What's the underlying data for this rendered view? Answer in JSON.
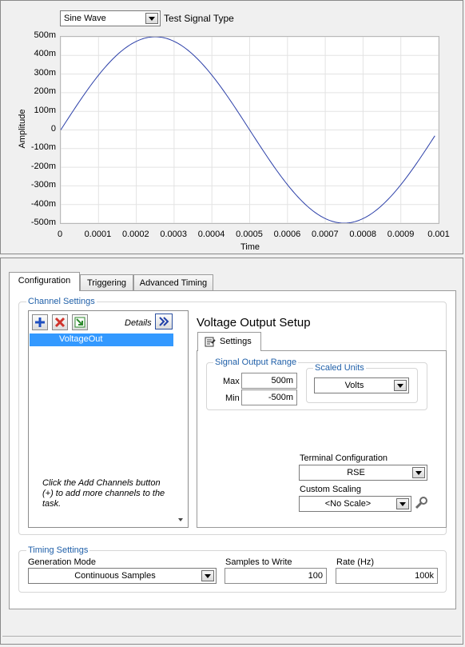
{
  "signal": {
    "selected": "Sine Wave",
    "label": "Test Signal Type"
  },
  "chart_data": {
    "type": "line",
    "xlabel": "Time",
    "ylabel": "Amplitude",
    "xlim": [
      0,
      0.001
    ],
    "ylim": [
      -0.5,
      0.5
    ],
    "x_ticks": [
      "0",
      "0.0001",
      "0.0002",
      "0.0003",
      "0.0004",
      "0.0005",
      "0.0006",
      "0.0007",
      "0.0008",
      "0.0009",
      "0.001"
    ],
    "y_ticks": [
      "500m",
      "400m",
      "300m",
      "200m",
      "100m",
      "0",
      "-100m",
      "-200m",
      "-300m",
      "-400m",
      "-500m"
    ],
    "grid": true,
    "series": [
      {
        "color": "#2b3fa8",
        "function": "0.5*sin(2*pi*1000*t)",
        "x": [
          0,
          5e-05,
          0.0001,
          0.00015,
          0.0002,
          0.00025,
          0.0003,
          0.00035,
          0.0004,
          0.00045,
          0.0005,
          0.00055,
          0.0006,
          0.00065,
          0.0007,
          0.00075,
          0.0008,
          0.00085,
          0.0009,
          0.00095,
          0.00099
        ],
        "y": [
          0,
          0.155,
          0.294,
          0.405,
          0.476,
          0.5,
          0.476,
          0.405,
          0.294,
          0.155,
          0,
          -0.155,
          -0.294,
          -0.405,
          -0.476,
          -0.5,
          -0.476,
          -0.405,
          -0.294,
          -0.155,
          -0.031
        ]
      }
    ]
  },
  "tabs": [
    "Configuration",
    "Triggering",
    "Advanced Timing"
  ],
  "channel_settings": {
    "title": "Channel Settings",
    "details_label": "Details",
    "channels": [
      "VoltageOut"
    ],
    "hint": "Click the Add Channels button (+) to add more channels to the task."
  },
  "voltage_setup": {
    "title": "Voltage Output Setup",
    "settings_tab": "Settings",
    "range_title": "Signal Output Range",
    "max_label": "Max",
    "max_value": "500m",
    "min_label": "Min",
    "min_value": "-500m",
    "units_title": "Scaled Units",
    "units_value": "Volts",
    "terminal_label": "Terminal Configuration",
    "terminal_value": "RSE",
    "scaling_label": "Custom Scaling",
    "scaling_value": "<No Scale>"
  },
  "timing": {
    "title": "Timing Settings",
    "mode_label": "Generation Mode",
    "mode_value": "Continuous Samples",
    "samples_label": "Samples to Write",
    "samples_value": "100",
    "rate_label": "Rate (Hz)",
    "rate_value": "100k"
  },
  "colors": {
    "accent_blue": "#1f5fa8",
    "selection": "#3399ff",
    "plot_line": "#2b3fa8"
  }
}
